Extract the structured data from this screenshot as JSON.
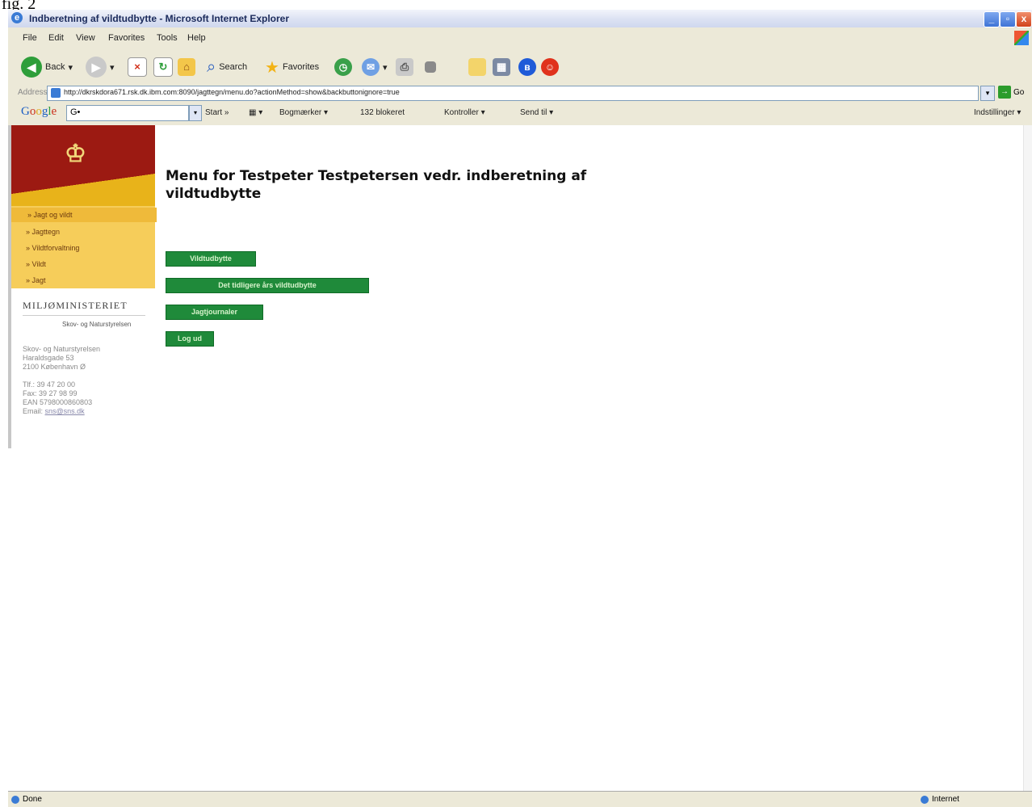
{
  "caption": "fig. 2",
  "window": {
    "title": "Indberetning af vildtudbytte - Microsoft Internet Explorer",
    "controls": {
      "minimize": "_",
      "maximize": "▫",
      "close": "x"
    }
  },
  "menubar": [
    "File",
    "Edit",
    "View",
    "Favorites",
    "Tools",
    "Help"
  ],
  "toolbar": {
    "back": "Back",
    "search": "Search",
    "favorites": "Favorites"
  },
  "address": {
    "label": "Address",
    "url": "http://dkrskdora671.rsk.dk.ibm.com:8090/jagttegn/menu.do?actionMethod=show&backbuttonignore=true",
    "go": "Go"
  },
  "googlebar": {
    "logo": "Google",
    "search_prefix": "G•",
    "items": [
      "Start »",
      "Bogmærker ▾",
      "132 blokeret",
      "Kontroller ▾",
      "Send til ▾"
    ],
    "settings": "Indstillinger ▾"
  },
  "sidebar": {
    "nav": [
      "» Jagt og vildt",
      "» Jagttegn",
      "» Vildtforvaltning",
      "» Vildt",
      "» Jagt"
    ],
    "ministry": "MILJØMINISTERIET",
    "agency": "Skov- og Naturstyrelsen",
    "contact": [
      "Skov- og Naturstyrelsen",
      "Haraldsgade 53",
      "2100 København Ø",
      "",
      "Tlf.: 39 47 20 00",
      "Fax: 39 27 98 99",
      "EAN 5798000860803",
      "Email: sns@sns.dk"
    ],
    "email_label": "Email:",
    "email": "sns@sns.dk"
  },
  "main": {
    "heading": "Menu for Testpeter Testpetersen vedr. indberetning af vildtudbytte",
    "buttons": [
      "Vildtudbytte",
      "Det tidligere års vildtudbytte",
      "Jagtjournaler",
      "Log ud"
    ]
  },
  "status": {
    "left": "Done",
    "zone": "Internet"
  }
}
